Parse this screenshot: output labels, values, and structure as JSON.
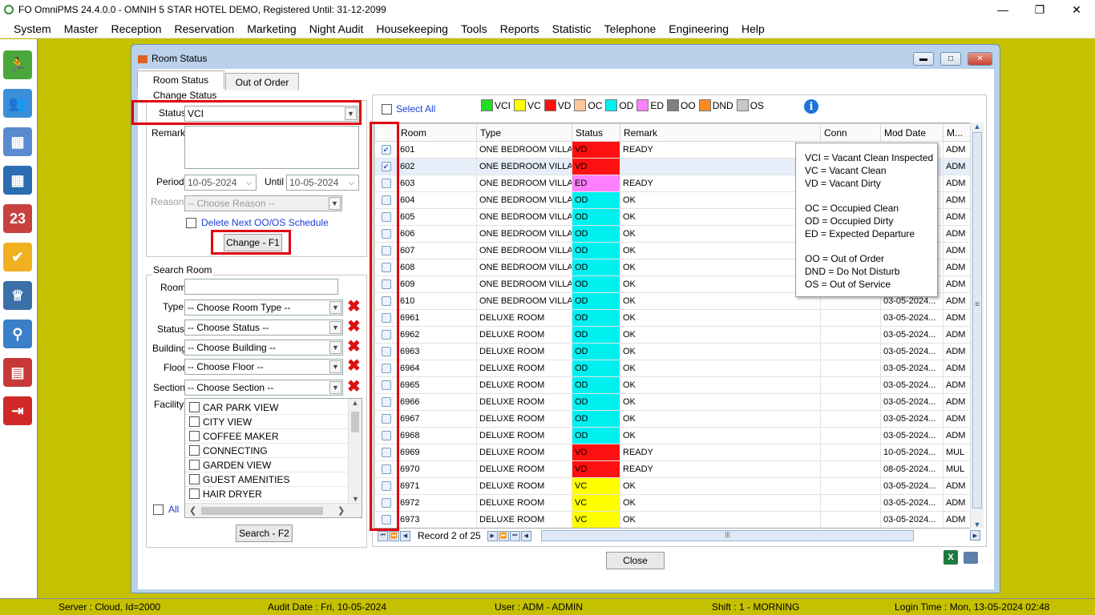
{
  "app": {
    "title": "FO OmniPMS 24.4.0.0 - OMNIH 5 STAR HOTEL DEMO, Registered Until: 31-12-2099"
  },
  "menu": [
    "System",
    "Master",
    "Reception",
    "Reservation",
    "Marketing",
    "Night Audit",
    "Housekeeping",
    "Tools",
    "Reports",
    "Statistic",
    "Telephone",
    "Engineering",
    "Help"
  ],
  "sidebar_icons": [
    "walk-in-icon",
    "guests-icon",
    "floor-plan-icon",
    "calendar-grid-icon",
    "calendar-2023-icon",
    "badge-check-icon",
    "housekeeping-icon",
    "search-analytics-icon",
    "chart-icon",
    "logout-icon"
  ],
  "dialog": {
    "title": "Room Status",
    "tabs": [
      "Room Status",
      "Out of Order"
    ],
    "change_status": {
      "group_label": "Change Status",
      "status_label": "Status",
      "status_value": "VCI",
      "remark_label": "Remark",
      "period_label": "Period",
      "period_from": "10-05-2024",
      "until_label": "Until",
      "period_until": "10-05-2024",
      "reason_label": "Reason",
      "reason_placeholder": "-- Choose Reason --",
      "delete_next_label": "Delete Next OO/OS Schedule",
      "change_button": "Change - F1"
    },
    "search_room": {
      "group_label": "Search Room",
      "room_label": "Room",
      "room_value": "",
      "type_label": "Type",
      "type_placeholder": "-- Choose Room Type --",
      "status_label": "Status",
      "status_placeholder": "-- Choose Status --",
      "building_label": "Building",
      "building_placeholder": "-- Choose Building --",
      "floor_label": "Floor",
      "floor_placeholder": "-- Choose Floor --",
      "section_label": "Section",
      "section_placeholder": "-- Choose Section --",
      "facility_label": "Facility",
      "facilities": [
        "CAR PARK VIEW",
        "CITY VIEW",
        "COFFEE MAKER",
        "CONNECTING",
        "GARDEN VIEW",
        "GUEST AMENITIES",
        "HAIR DRYER"
      ],
      "all_label": "All",
      "search_button": "Search - F2"
    },
    "select_all_label": "Select All",
    "legend": [
      {
        "code": "VCI",
        "color": "#22dd22"
      },
      {
        "code": "VC",
        "color": "#ffff00"
      },
      {
        "code": "VD",
        "color": "#ff1010"
      },
      {
        "code": "OC",
        "color": "#ffc89a"
      },
      {
        "code": "OD",
        "color": "#00f0f0"
      },
      {
        "code": "ED",
        "color": "#ff80ff"
      },
      {
        "code": "OO",
        "color": "#808080"
      },
      {
        "code": "DND",
        "color": "#ff8a20"
      },
      {
        "code": "OS",
        "color": "#c8c8c8"
      }
    ],
    "grid": {
      "headers": [
        "",
        "Room",
        "Type",
        "Status",
        "Remark",
        "Conn",
        "Mod Date",
        "M..."
      ],
      "rows": [
        {
          "checked": true,
          "room": "601",
          "type": "ONE BEDROOM VILLA",
          "status": "VD",
          "status_color": "#ff1010",
          "remark": "READY",
          "conn": "",
          "mod_date": "",
          "mod_by": "ADM"
        },
        {
          "checked": true,
          "room": "602",
          "type": "ONE BEDROOM VILLA",
          "status": "VD",
          "status_color": "#ff1010",
          "remark": "",
          "conn": "",
          "mod_date": "",
          "mod_by": "ADM"
        },
        {
          "checked": false,
          "room": "603",
          "type": "ONE BEDROOM VILLA",
          "status": "ED",
          "status_color": "#ff80ff",
          "remark": "READY",
          "conn": "",
          "mod_date": "",
          "mod_by": "ADM"
        },
        {
          "checked": false,
          "room": "604",
          "type": "ONE BEDROOM VILLA",
          "status": "OD",
          "status_color": "#00f0f0",
          "remark": "OK",
          "conn": "",
          "mod_date": "",
          "mod_by": "ADM"
        },
        {
          "checked": false,
          "room": "605",
          "type": "ONE BEDROOM VILLA",
          "status": "OD",
          "status_color": "#00f0f0",
          "remark": "OK",
          "conn": "",
          "mod_date": "",
          "mod_by": "ADM"
        },
        {
          "checked": false,
          "room": "606",
          "type": "ONE BEDROOM VILLA",
          "status": "OD",
          "status_color": "#00f0f0",
          "remark": "OK",
          "conn": "",
          "mod_date": "",
          "mod_by": "ADM"
        },
        {
          "checked": false,
          "room": "607",
          "type": "ONE BEDROOM VILLA",
          "status": "OD",
          "status_color": "#00f0f0",
          "remark": "OK",
          "conn": "",
          "mod_date": "",
          "mod_by": "ADM"
        },
        {
          "checked": false,
          "room": "608",
          "type": "ONE BEDROOM VILLA",
          "status": "OD",
          "status_color": "#00f0f0",
          "remark": "OK",
          "conn": "",
          "mod_date": "",
          "mod_by": "ADM"
        },
        {
          "checked": false,
          "room": "609",
          "type": "ONE BEDROOM VILLA",
          "status": "OD",
          "status_color": "#00f0f0",
          "remark": "OK",
          "conn": "",
          "mod_date": "",
          "mod_by": "ADM"
        },
        {
          "checked": false,
          "room": "610",
          "type": "ONE BEDROOM VILLA",
          "status": "OD",
          "status_color": "#00f0f0",
          "remark": "OK",
          "conn": "",
          "mod_date": "03-05-2024...",
          "mod_by": "ADM"
        },
        {
          "checked": false,
          "room": "6961",
          "type": "DELUXE ROOM",
          "status": "OD",
          "status_color": "#00f0f0",
          "remark": "OK",
          "conn": "",
          "mod_date": "03-05-2024...",
          "mod_by": "ADM"
        },
        {
          "checked": false,
          "room": "6962",
          "type": "DELUXE ROOM",
          "status": "OD",
          "status_color": "#00f0f0",
          "remark": "OK",
          "conn": "",
          "mod_date": "03-05-2024...",
          "mod_by": "ADM"
        },
        {
          "checked": false,
          "room": "6963",
          "type": "DELUXE ROOM",
          "status": "OD",
          "status_color": "#00f0f0",
          "remark": "OK",
          "conn": "",
          "mod_date": "03-05-2024...",
          "mod_by": "ADM"
        },
        {
          "checked": false,
          "room": "6964",
          "type": "DELUXE ROOM",
          "status": "OD",
          "status_color": "#00f0f0",
          "remark": "OK",
          "conn": "",
          "mod_date": "03-05-2024...",
          "mod_by": "ADM"
        },
        {
          "checked": false,
          "room": "6965",
          "type": "DELUXE ROOM",
          "status": "OD",
          "status_color": "#00f0f0",
          "remark": "OK",
          "conn": "",
          "mod_date": "03-05-2024...",
          "mod_by": "ADM"
        },
        {
          "checked": false,
          "room": "6966",
          "type": "DELUXE ROOM",
          "status": "OD",
          "status_color": "#00f0f0",
          "remark": "OK",
          "conn": "",
          "mod_date": "03-05-2024...",
          "mod_by": "ADM"
        },
        {
          "checked": false,
          "room": "6967",
          "type": "DELUXE ROOM",
          "status": "OD",
          "status_color": "#00f0f0",
          "remark": "OK",
          "conn": "",
          "mod_date": "03-05-2024...",
          "mod_by": "ADM"
        },
        {
          "checked": false,
          "room": "6968",
          "type": "DELUXE ROOM",
          "status": "OD",
          "status_color": "#00f0f0",
          "remark": "OK",
          "conn": "",
          "mod_date": "03-05-2024...",
          "mod_by": "ADM"
        },
        {
          "checked": false,
          "room": "6969",
          "type": "DELUXE ROOM",
          "status": "VD",
          "status_color": "#ff1010",
          "remark": "READY",
          "conn": "",
          "mod_date": "10-05-2024...",
          "mod_by": "MUL"
        },
        {
          "checked": false,
          "room": "6970",
          "type": "DELUXE ROOM",
          "status": "VD",
          "status_color": "#ff1010",
          "remark": "READY",
          "conn": "",
          "mod_date": "08-05-2024...",
          "mod_by": "MUL"
        },
        {
          "checked": false,
          "room": "6971",
          "type": "DELUXE ROOM",
          "status": "VC",
          "status_color": "#ffff00",
          "remark": "OK",
          "conn": "",
          "mod_date": "03-05-2024...",
          "mod_by": "ADM"
        },
        {
          "checked": false,
          "room": "6972",
          "type": "DELUXE ROOM",
          "status": "VC",
          "status_color": "#ffff00",
          "remark": "OK",
          "conn": "",
          "mod_date": "03-05-2024...",
          "mod_by": "ADM"
        },
        {
          "checked": false,
          "room": "6973",
          "type": "DELUXE ROOM",
          "status": "VC",
          "status_color": "#ffff00",
          "remark": "OK",
          "conn": "",
          "mod_date": "03-05-2024...",
          "mod_by": "ADM"
        }
      ]
    },
    "record_text": "Record 2 of 25",
    "tooltip_lines": [
      "VCI = Vacant Clean Inspected",
      "VC = Vacant Clean",
      "VD = Vacant Dirty",
      "",
      "OC = Occupied Clean",
      "OD = Occupied Dirty",
      "ED = Expected Departure",
      "",
      "OO = Out of Order",
      "DND = Do Not Disturb",
      "OS = Out of Service"
    ],
    "close_button": "Close"
  },
  "statusbar": {
    "server": "Server : Cloud, Id=2000",
    "audit_date": "Audit Date : Fri, 10-05-2024",
    "user": "User : ADM - ADMIN",
    "shift": "Shift : 1 - MORNING",
    "login_time": "Login Time : Mon, 13-05-2024 02:48"
  }
}
